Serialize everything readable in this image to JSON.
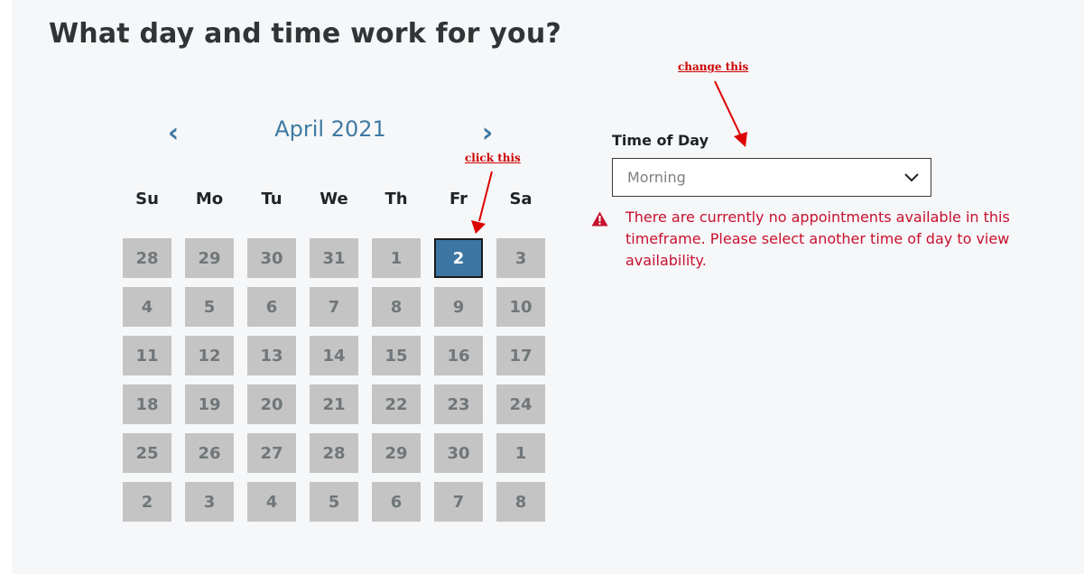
{
  "page": {
    "title": "What day and time work for you?"
  },
  "calendar": {
    "month_label": "April 2021",
    "prev_glyph": "‹",
    "next_glyph": "›",
    "weekdays": [
      "Su",
      "Mo",
      "Tu",
      "We",
      "Th",
      "Fr",
      "Sa"
    ],
    "selected_day": "2",
    "days": [
      "28",
      "29",
      "30",
      "31",
      "1",
      "2",
      "3",
      "4",
      "5",
      "6",
      "7",
      "8",
      "9",
      "10",
      "11",
      "12",
      "13",
      "14",
      "15",
      "16",
      "17",
      "18",
      "19",
      "20",
      "21",
      "22",
      "23",
      "24",
      "25",
      "26",
      "27",
      "28",
      "29",
      "30",
      "1",
      "2",
      "3",
      "4",
      "5",
      "6",
      "7",
      "8"
    ]
  },
  "time_of_day": {
    "label": "Time of Day",
    "selected_value": "Morning"
  },
  "error": {
    "icon": "warning-icon",
    "message": "There are currently no appointments available in this timeframe. Please select another time of day to view availability."
  },
  "annotations": {
    "click_this": "click this",
    "change_this": "change this"
  },
  "colors": {
    "accent": "#3f7aa3",
    "selected_day": "#3d76a2",
    "disabled_day": "#c4c4c4",
    "error": "#c8102e",
    "annotation": "#cc0000"
  }
}
